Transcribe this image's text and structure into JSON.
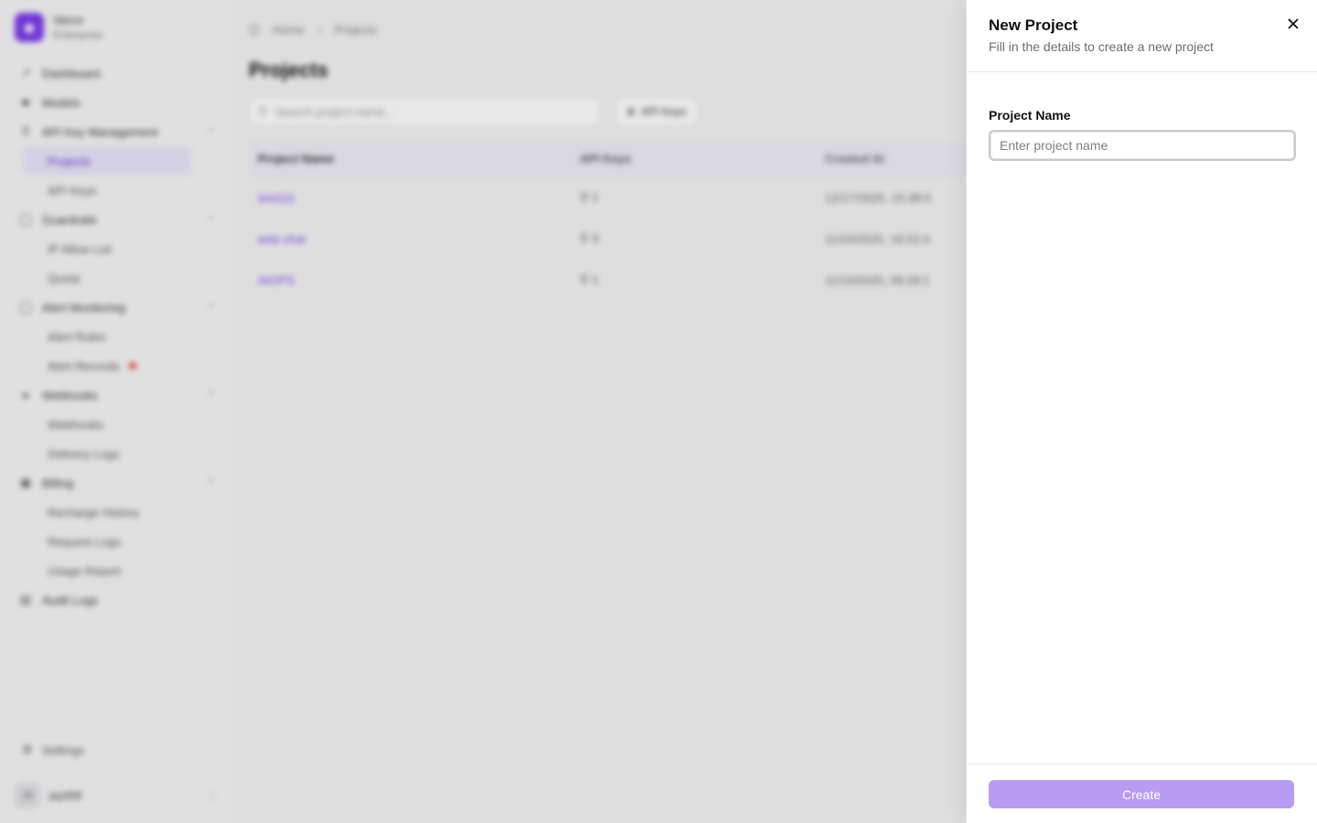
{
  "app": {
    "brand": {
      "name": "Vance",
      "plan": "Enterprise",
      "logo_icon": "shield-icon"
    },
    "sidebar": {
      "items": [
        {
          "label": "Dashboard",
          "icon": "chart-icon"
        },
        {
          "label": "Models",
          "icon": "box-icon"
        },
        {
          "label": "API Key Management",
          "icon": "key-icon",
          "sub": [
            "Projects",
            "API Keys"
          ]
        },
        {
          "label": "Guardrails",
          "icon": "shield-icon",
          "sub": [
            "IP Allow List",
            "Quota"
          ]
        },
        {
          "label": "Alert Monitoring",
          "icon": "bell-icon",
          "sub": [
            "Alert Rules",
            "Alert Records"
          ]
        },
        {
          "label": "Webhooks",
          "icon": "webhook-icon",
          "sub": [
            "Webhooks",
            "Delivery Logs"
          ]
        },
        {
          "label": "Billing",
          "icon": "wallet-icon",
          "sub": [
            "Recharge History",
            "Request Logs",
            "Usage Report"
          ]
        },
        {
          "label": "Audit Logs",
          "icon": "file-icon"
        }
      ],
      "active_sub": "Projects",
      "footer": {
        "settings_label": "Settings",
        "user_initials": "JS",
        "user_name": "jay008"
      }
    },
    "breadcrumb": {
      "home": "Home",
      "current": "Projects"
    },
    "page_title": "Projects",
    "search_placeholder": "Search project name...",
    "filter_label": "API Keys",
    "table": {
      "headers": [
        "Project Name",
        "API Keys",
        "Created At"
      ],
      "rows": [
        {
          "name": "test111",
          "keys": "1",
          "created": "12/17/2025, 15:38:0"
        },
        {
          "name": "web chat",
          "keys": "3",
          "created": "11/24/2025, 16:52:4"
        },
        {
          "name": "AIOPS",
          "keys": "1",
          "created": "11/10/2025, 09:28:1"
        }
      ]
    }
  },
  "drawer": {
    "title": "New Project",
    "description": "Fill in the details to create a new project",
    "field_label": "Project Name",
    "field_placeholder": "Enter project name",
    "field_value": "",
    "submit_label": "Create",
    "submit_color": "#b89cf2"
  }
}
